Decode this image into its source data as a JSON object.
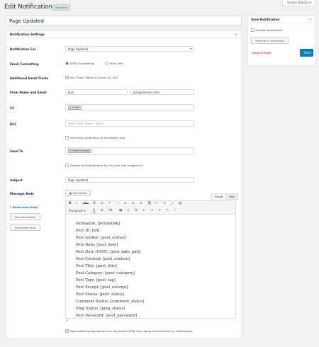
{
  "header": {
    "screen_options": "Screen Options",
    "title": "Edit Notification",
    "add_new": "Add New"
  },
  "post_title": "Page Updated",
  "settings": {
    "title": "Notification Settings",
    "collapse": "▴",
    "notification_for": {
      "label": "Notification For",
      "value": "Page Updated"
    },
    "email_formatting": {
      "label": "Email Formatting",
      "option_html": "HTML Formatting",
      "option_plain": "Plain Text",
      "selected": "html"
    },
    "additional_fields": {
      "label": "Additional Email Fields",
      "checkbox": "Set \"From\" Name & Email, CC, BCC",
      "checked": true
    },
    "from": {
      "label": "From Name and Email",
      "name": "Jack",
      "email": "jack@domain.com"
    },
    "cc": {
      "label": "CC",
      "tag": "Editor"
    },
    "bcc": {
      "label": "BCC",
      "placeholder": "Select User Roles / Users",
      "author_checkbox": "Send this notification to the Author only",
      "author_checked": false
    },
    "send_to": {
      "label": "Send To",
      "tag": "Administrator",
      "disable_checkbox": "Disable this Notification for the User that triggered it",
      "disable_checked": false
    },
    "subject": {
      "label": "Subject",
      "value": "Page Updated"
    },
    "message_body": {
      "label": "Message Body",
      "add_media": "Add Media",
      "tab_visual": "Visual",
      "tab_text": "Text",
      "paragraph": "Paragraph",
      "lines": [
        "Permalink: [permalink]",
        "Post ID: [ID]",
        "Post Author: [post_author]",
        "Post Date: [post_date]",
        "Post Date (GMT): [post_date_gmt]",
        "Post Content: [post_content]",
        "Post Title: [post_title]",
        "Post Category: [post_category]",
        "Post Tags: [post_tag]",
        "Post Except: [post_excerpt]",
        "Post Status: [post_status]",
        "Comment Status: [comment_status]",
        "Ping Status: [ping_status]",
        "Post Password: [post_password]"
      ],
      "path": "p"
    },
    "help": {
      "link": "Need some help?",
      "documentation": "Documentation",
      "shortcode_help": "Shortcode Help"
    },
    "stop_paragraph": {
      "label": "Stop additional paragraph and line break HTML from being inserted into my notifications",
      "checked": true
    }
  },
  "save_box": {
    "title": "Save Notification",
    "collapse": "▴",
    "disable_label": "Disable Notification",
    "test_email": "Send Me a Test Email",
    "trash": "Move to Trash",
    "save": "Save"
  }
}
